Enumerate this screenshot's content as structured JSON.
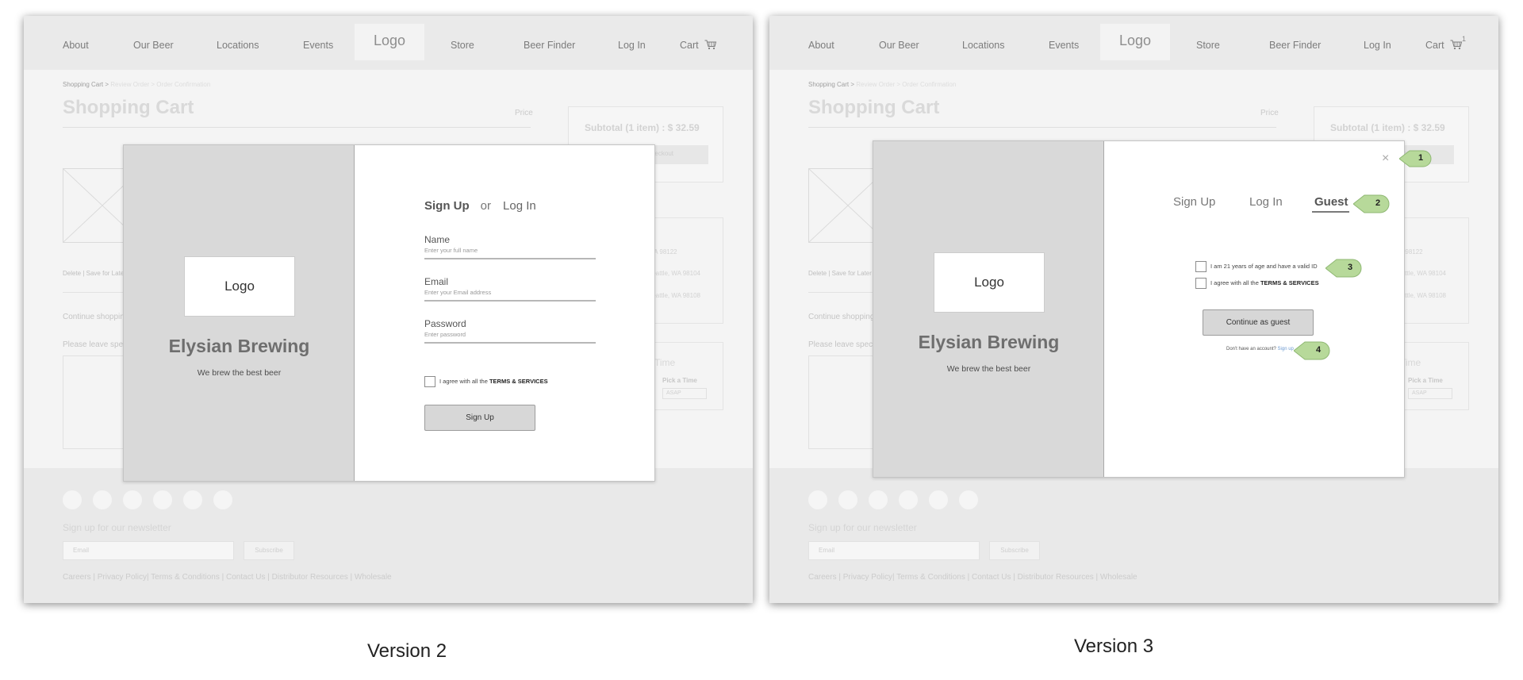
{
  "nav": {
    "items": [
      "About",
      "Our Beer",
      "Locations",
      "Events",
      "Store",
      "Beer Finder",
      "Log In",
      "Cart"
    ],
    "logo": "Logo",
    "cart_count_v3": "1"
  },
  "page": {
    "breadcrumb": "Shopping Cart >",
    "breadcrumb_faded": "Review Order >  Order Confirmation",
    "title": "Shopping Cart",
    "price_label": "Price",
    "subtotal": "Subtotal (1 item) : $ 32.59",
    "checkout_label": "Checkout",
    "item_links": "Delete | Save for Later",
    "continue_link": "Continue shopping",
    "leave_note": "Please leave special instructions",
    "addresses": [
      "WA 98122",
      "Seattle, WA 98104",
      "Seattle, WA 98108"
    ],
    "time_title": "Time",
    "pick_time": "Pick a Time",
    "asap": "ASAP"
  },
  "footer": {
    "newsletter_title": "Sign up for our newsletter",
    "email_placeholder": "Email",
    "subscribe": "Subscribe",
    "links": "Careers | Privacy Policy| Terms & Conditions | Contact Us | Distributor Resources  | Wholesale"
  },
  "brand": {
    "logo": "Logo",
    "name": "Elysian Brewing",
    "tagline": "We brew the best beer"
  },
  "v2": {
    "caption": "Version 2",
    "tab_signup": "Sign Up",
    "tab_or": "or",
    "tab_login": "Log In",
    "name_label": "Name",
    "name_placeholder": "Enter your full name",
    "email_label": "Email",
    "email_placeholder": "Enter your Email address",
    "password_label": "Password",
    "password_placeholder": "Enter password",
    "agree_text": "I agree with all the ",
    "terms": "TERMS & SERVICES",
    "signup_button": "Sign Up"
  },
  "v3": {
    "caption": "Version 3",
    "close": "×",
    "tab_signup": "Sign Up",
    "tab_login": "Log In",
    "tab_guest": "Guest",
    "age_check": "I am 21 years of age and have a valid ID",
    "agree_text": "I agree with all the ",
    "terms": "TERMS & SERVICES",
    "guest_button": "Continue as guest",
    "no_account": "Don't have an account? ",
    "signup_link": "Sign up",
    "callouts": [
      "1",
      "2",
      "3",
      "4"
    ],
    "callout_color": "#b7d99a"
  }
}
